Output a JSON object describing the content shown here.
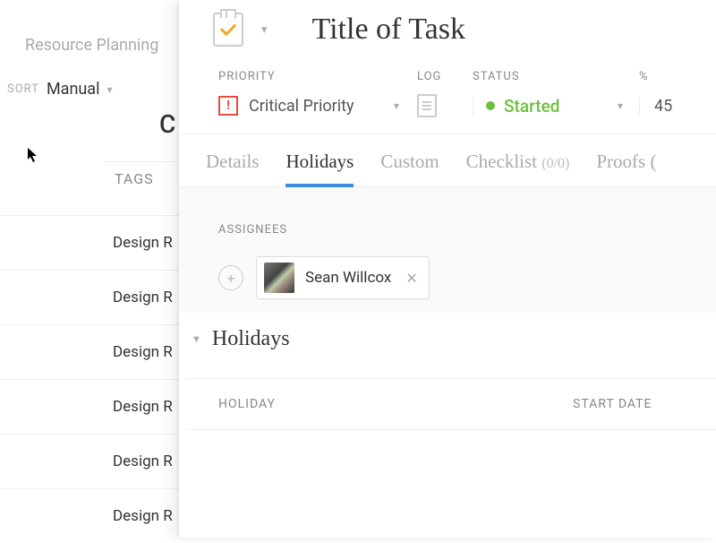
{
  "left": {
    "breadcrumb": "Resource Planning",
    "sort_label": "SORT",
    "sort_value": "Manual",
    "column_letter": "C",
    "tags_header": "TAGS",
    "rows": [
      {
        "title": "Design R"
      },
      {
        "title": "Design R"
      },
      {
        "title": "Design R"
      },
      {
        "title": "Design R"
      },
      {
        "title": "Design R"
      },
      {
        "title": "Design R"
      }
    ]
  },
  "panel": {
    "title": "Title of Task",
    "meta": {
      "priority_label": "PRIORITY",
      "log_label": "LOG",
      "status_label": "STATUS",
      "percent_label": "%",
      "priority_value": "Critical Priority",
      "status_value": "Started",
      "percent_value": "45",
      "status_color": "#6bbf3b"
    },
    "tabs": {
      "details": "Details",
      "holidays": "Holidays",
      "custom": "Custom",
      "checklist": "Checklist",
      "checklist_count": "(0/0)",
      "proofs": "Proofs ("
    },
    "assignees": {
      "label": "ASSIGNEES",
      "items": [
        {
          "name": "Sean Willcox"
        }
      ]
    },
    "holidays_section": {
      "title": "Holidays",
      "table": {
        "holiday_header": "HOLIDAY",
        "start_header": "START DATE"
      }
    }
  }
}
